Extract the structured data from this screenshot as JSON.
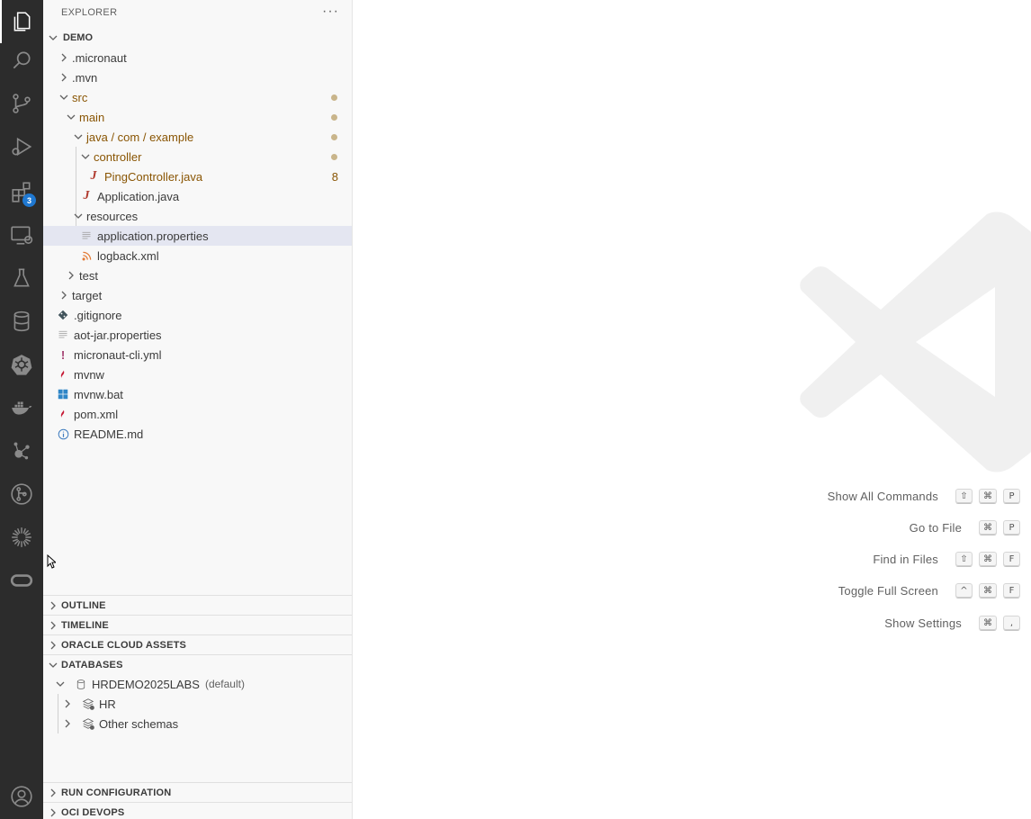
{
  "sidebar": {
    "title": "EXPLORER",
    "more_label": "···",
    "root": "DEMO",
    "tree": [
      {
        "label": ".micronaut",
        "depth": 1,
        "kind": "folder",
        "open": false,
        "modified": false,
        "icon": "chevron-right-icon"
      },
      {
        "label": ".mvn",
        "depth": 1,
        "kind": "folder",
        "open": false,
        "modified": false
      },
      {
        "label": "src",
        "depth": 1,
        "kind": "folder",
        "open": true,
        "modified": true
      },
      {
        "label": "main",
        "depth": 2,
        "kind": "folder",
        "open": true,
        "modified": true
      },
      {
        "label": "java / com / example",
        "depth": 3,
        "kind": "folder",
        "open": true,
        "modified": true
      },
      {
        "label": "controller",
        "depth": 4,
        "kind": "folder",
        "open": true,
        "modified": true
      },
      {
        "label": "PingController.java",
        "depth": 5,
        "kind": "java",
        "modified": true,
        "problems": "8"
      },
      {
        "label": "Application.java",
        "depth": 4,
        "kind": "java",
        "modified": false
      },
      {
        "label": "resources",
        "depth": 3,
        "kind": "folder",
        "open": true,
        "modified": false
      },
      {
        "label": "application.properties",
        "depth": 4,
        "kind": "properties",
        "selected": true
      },
      {
        "label": "logback.xml",
        "depth": 4,
        "kind": "xml-rss"
      },
      {
        "label": "test",
        "depth": 2,
        "kind": "folder",
        "open": false
      },
      {
        "label": "target",
        "depth": 1,
        "kind": "folder",
        "open": false
      },
      {
        "label": ".gitignore",
        "depth": 1,
        "kind": "git"
      },
      {
        "label": "aot-jar.properties",
        "depth": 1,
        "kind": "properties"
      },
      {
        "label": "micronaut-cli.yml",
        "depth": 1,
        "kind": "yaml"
      },
      {
        "label": "mvnw",
        "depth": 1,
        "kind": "maven"
      },
      {
        "label": "mvnw.bat",
        "depth": 1,
        "kind": "windows"
      },
      {
        "label": "pom.xml",
        "depth": 1,
        "kind": "maven"
      },
      {
        "label": "README.md",
        "depth": 1,
        "kind": "info"
      }
    ],
    "sections": {
      "outline": "OUTLINE",
      "timeline": "TIMELINE",
      "oracle_cloud_assets": "ORACLE CLOUD ASSETS",
      "databases": "DATABASES",
      "run_configuration": "RUN CONFIGURATION",
      "oci_devops": "OCI DEVOPS"
    },
    "databases": {
      "connection": "HRDEMO2025LABS",
      "connection_tag": "(default)",
      "schemas": [
        "HR",
        "Other schemas"
      ]
    }
  },
  "activity_bar": {
    "items": [
      "explorer-icon",
      "search-icon",
      "source-control-icon",
      "run-debug-icon",
      "extensions-icon",
      "remote-explorer-icon",
      "testing-icon",
      "database-icon",
      "kubernetes-icon",
      "docker-icon",
      "graph-icon",
      "git-graph-icon",
      "spinner-icon",
      "oracle-icon",
      "account-icon"
    ],
    "extensions_badge": "3"
  },
  "editor": {
    "shortcuts": [
      {
        "label": "Show All Commands",
        "keys": [
          "⇧",
          "⌘",
          "P"
        ]
      },
      {
        "label": "Go to File",
        "keys": [
          "⌘",
          "P"
        ]
      },
      {
        "label": "Find in Files",
        "keys": [
          "⇧",
          "⌘",
          "F"
        ]
      },
      {
        "label": "Toggle Full Screen",
        "keys": [
          "^",
          "⌘",
          "F"
        ]
      },
      {
        "label": "Show Settings",
        "keys": [
          "⌘",
          ","
        ]
      }
    ]
  },
  "colors": {
    "activity_bar_bg": "#2c2c2c",
    "sidebar_bg": "#f8f8f8",
    "modified_text": "#895503",
    "badge": "#1f78d1",
    "selection": "#e4e6f1"
  }
}
